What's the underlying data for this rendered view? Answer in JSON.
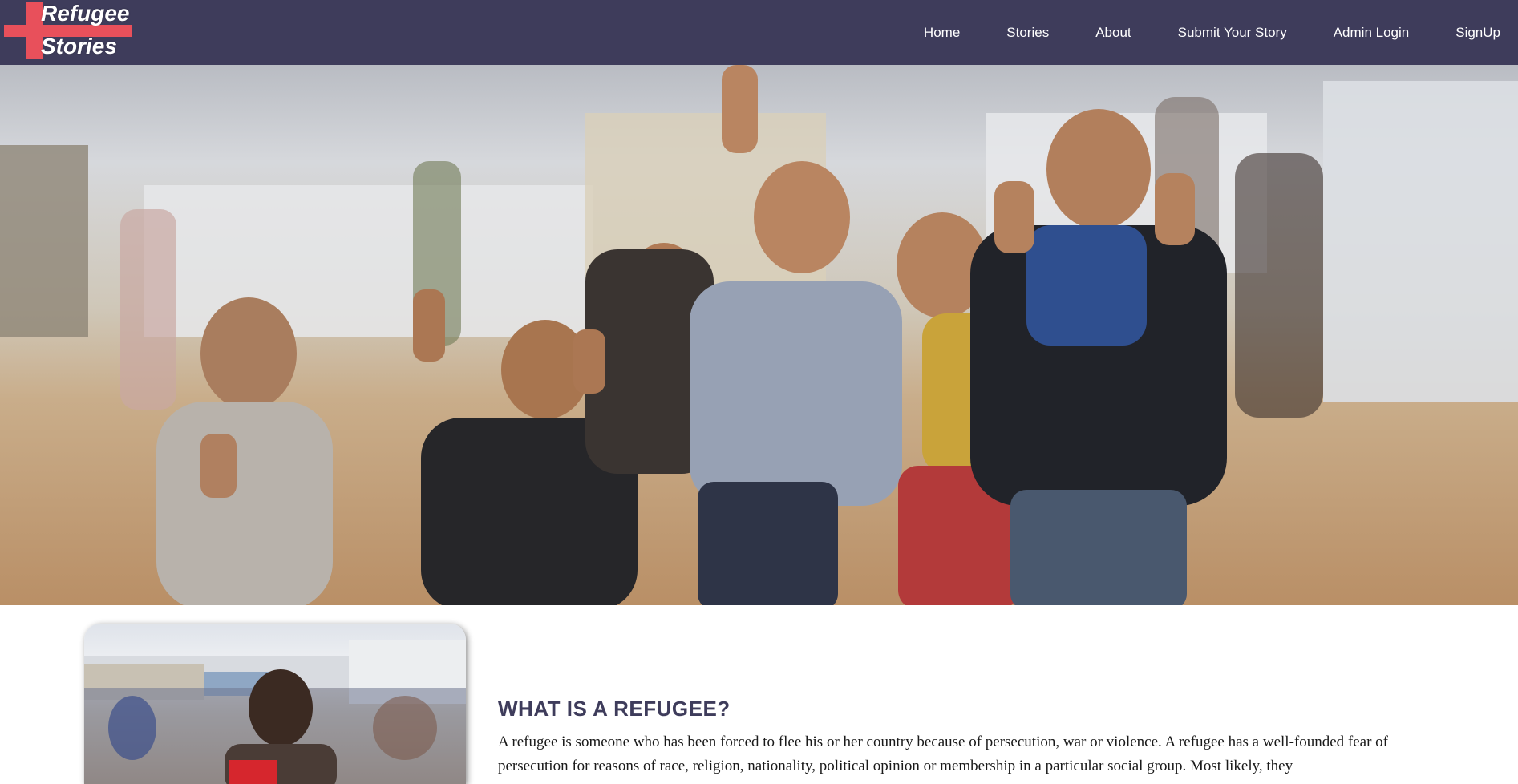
{
  "brand": {
    "line1": "Refugee",
    "line2": "Stories",
    "accent_color": "#e8505b",
    "nav_bg_color": "#3e3c5b"
  },
  "nav": {
    "items": [
      {
        "label": "Home"
      },
      {
        "label": "Stories"
      },
      {
        "label": "About"
      },
      {
        "label": "Submit Your Story"
      },
      {
        "label": "Admin Login"
      },
      {
        "label": "SignUp"
      }
    ]
  },
  "hero": {
    "image_subject": "children in refugee camp making peace signs"
  },
  "about": {
    "image_subject": "child in refugee camp with crowd behind",
    "heading": "WHAT IS A REFUGEE?",
    "paragraph": "A refugee is someone who has been forced to flee his or her country because of persecution, war or violence. A refugee has a well-founded fear of persecution for reasons of race, religion, nationality, political opinion or membership in a particular social group. Most likely, they"
  }
}
